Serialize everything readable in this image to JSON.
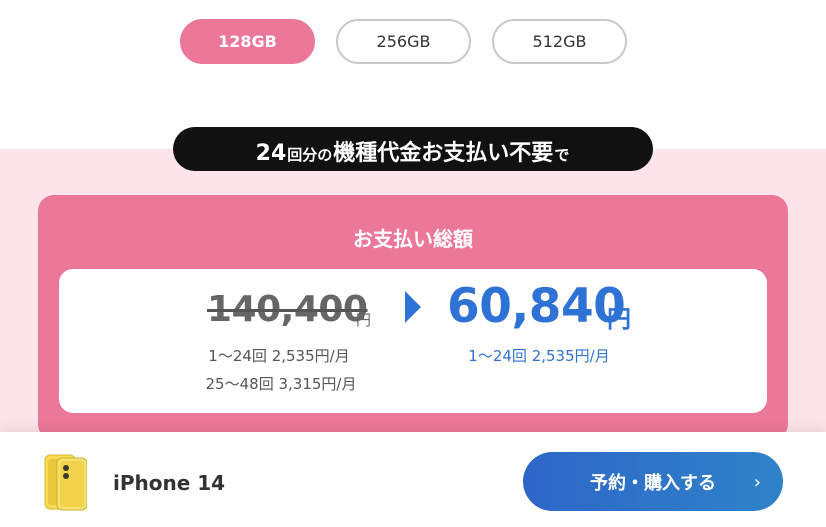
{
  "storage": {
    "options": [
      "128GB",
      "256GB",
      "512GB"
    ],
    "selected": "128GB"
  },
  "banner": {
    "part1": "24",
    "part2": "回分の",
    "part3": "機種代金お支払い不要",
    "part4": "で"
  },
  "total": {
    "title": "お支払い総額",
    "old_price": "140,400",
    "old_unit": "円",
    "old_monthly_1": "1〜24回 2,535円/月",
    "old_monthly_2": "25〜48回 3,315円/月",
    "new_price": "60,840",
    "new_unit": "円",
    "new_monthly": "1〜24回 2,535円/月"
  },
  "bottom_bar": {
    "product_name": "iPhone 14",
    "cta_label": "予約・購入する",
    "cta_chevron": "›"
  },
  "colors": {
    "accent_pink": "#ec7899",
    "band_pink": "#fde3ea",
    "price_blue": "#2f72d6",
    "phone_yellow": "#f6dc52"
  },
  "icons": {
    "arrow": "triangle-right-icon",
    "product": "iphone-yellow-image",
    "chevron": "chevron-right-icon"
  }
}
